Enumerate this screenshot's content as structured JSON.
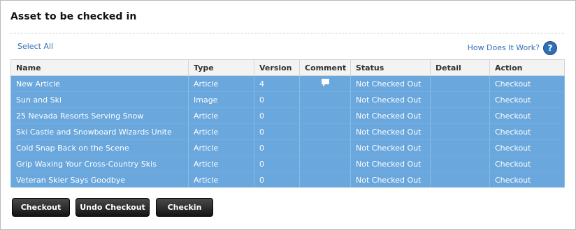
{
  "title": "Asset to be checked in",
  "links": {
    "select_all": "Select All",
    "how_does_it_work": "How Does It Work?",
    "help_icon": "?"
  },
  "table": {
    "headers": [
      "Name",
      "Type",
      "Version",
      "Comment",
      "Status",
      "Detail",
      "Action"
    ],
    "rows": [
      {
        "name": "New Article",
        "type": "Article",
        "version": "4",
        "comment_icon": "comment-icon",
        "status": "Not Checked Out",
        "detail": "",
        "action": "Checkout"
      },
      {
        "name": "Sun and Ski",
        "type": "Image",
        "version": "0",
        "comment_icon": "",
        "status": "Not Checked Out",
        "detail": "",
        "action": "Checkout"
      },
      {
        "name": "25 Nevada Resorts Serving Snow",
        "type": "Article",
        "version": "0",
        "comment_icon": "",
        "status": "Not Checked Out",
        "detail": "",
        "action": "Checkout"
      },
      {
        "name": "Ski Castle and Snowboard Wizards Unite",
        "type": "Article",
        "version": "0",
        "comment_icon": "",
        "status": "Not Checked Out",
        "detail": "",
        "action": "Checkout"
      },
      {
        "name": "Cold Snap Back on the Scene",
        "type": "Article",
        "version": "0",
        "comment_icon": "",
        "status": "Not Checked Out",
        "detail": "",
        "action": "Checkout"
      },
      {
        "name": "Grip Waxing Your Cross-Country Skis",
        "type": "Article",
        "version": "0",
        "comment_icon": "",
        "status": "Not Checked Out",
        "detail": "",
        "action": "Checkout"
      },
      {
        "name": "Veteran Skier Says Goodbye",
        "type": "Article",
        "version": "0",
        "comment_icon": "",
        "status": "Not Checked Out",
        "detail": "",
        "action": "Checkout"
      }
    ]
  },
  "buttons": {
    "checkout": "Checkout",
    "undo_checkout": "Undo Checkout",
    "checkin": "Checkin"
  },
  "colors": {
    "row_selected": "#6aa7dd",
    "link": "#2f6fb5",
    "header_bg": "#f3f3f3"
  }
}
